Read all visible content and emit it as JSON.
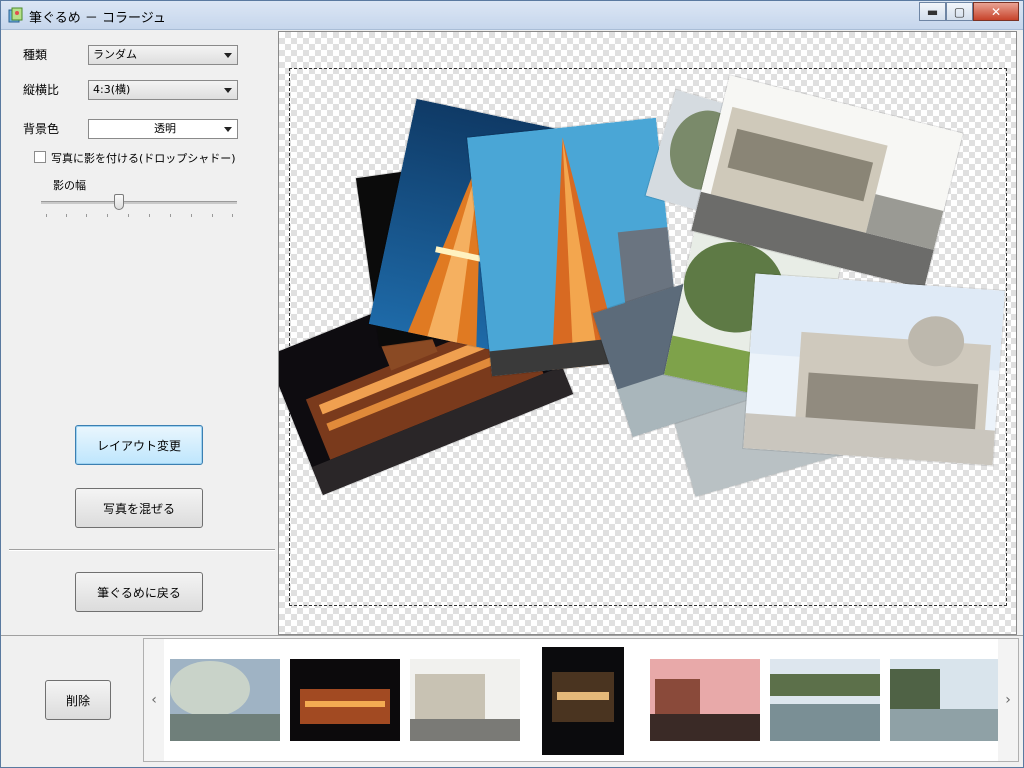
{
  "window": {
    "title": "筆ぐるめ － コラージュ",
    "minimize": "▬",
    "maximize": "▢",
    "close": "✕"
  },
  "left_panel": {
    "type_label": "種類",
    "type_value": "ランダム",
    "aspect_label": "縦横比",
    "aspect_value": "4:3(横)",
    "bg_label": "背景色",
    "bg_value": "透明",
    "shadow_checkbox_label": "写真に影を付ける(ドロップシャドー)",
    "shadow_checked": false,
    "shadow_width_label": "影の幅",
    "shadow_width_value": 0.4,
    "layout_button": "レイアウト変更",
    "mix_button": "写真を混ぜる",
    "back_button": "筆ぐるめに戻る"
  },
  "bottom": {
    "delete_button": "削除",
    "left_arrow": "‹",
    "right_arrow": "›"
  },
  "colors": {
    "accent": "#3c7fb1",
    "close": "#c7432b"
  }
}
